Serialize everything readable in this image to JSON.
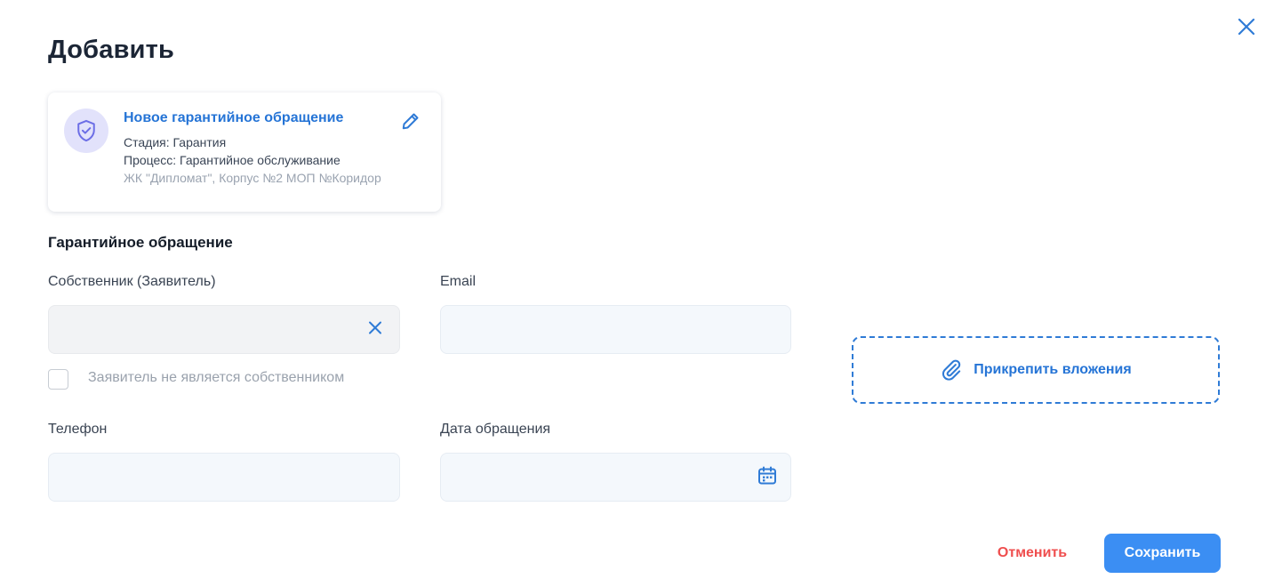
{
  "dialog": {
    "title": "Добавить"
  },
  "card": {
    "title": "Новое гарантийное обращение",
    "stage": "Стадия: Гарантия",
    "process": "Процесс: Гарантийное обслуживание",
    "address": "ЖК \"Дипломат\", Корпус №2 МОП №Коридор",
    "icon": "shield-check-icon"
  },
  "form": {
    "section_title": "Гарантийное обращение",
    "owner": {
      "label": "Собственник (Заявитель)",
      "value": ""
    },
    "email": {
      "label": "Email",
      "value": ""
    },
    "not_owner_checkbox": {
      "label": "Заявитель не является собственником",
      "checked": false
    },
    "phone": {
      "label": "Телефон",
      "value": ""
    },
    "date": {
      "label": "Дата обращения",
      "value": ""
    }
  },
  "attachments": {
    "label": "Прикрепить вложения",
    "icon": "paperclip-icon"
  },
  "actions": {
    "cancel_label": "Отменить",
    "save_label": "Сохранить"
  },
  "colors": {
    "accent": "#2574d6",
    "primary_button": "#3b8ef3",
    "danger": "#ef4e4e",
    "avatar_bg": "#e2e2fb",
    "avatar_icon": "#6c6ee6"
  }
}
